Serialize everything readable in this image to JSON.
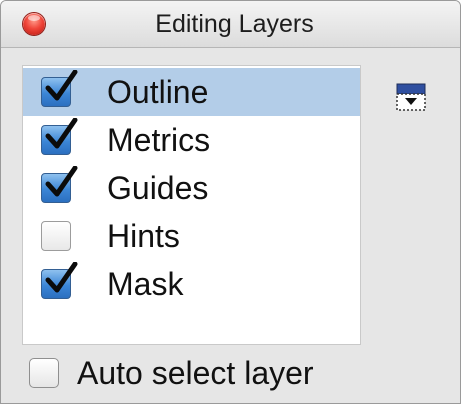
{
  "window": {
    "title": "Editing Layers"
  },
  "layers": [
    {
      "label": "Outline",
      "checked": true,
      "selected": true
    },
    {
      "label": "Metrics",
      "checked": true,
      "selected": false
    },
    {
      "label": "Guides",
      "checked": true,
      "selected": false
    },
    {
      "label": "Hints",
      "checked": false,
      "selected": false
    },
    {
      "label": "Mask",
      "checked": true,
      "selected": false
    }
  ],
  "options": {
    "auto_select_label": "Auto select layer",
    "auto_select_checked": false
  },
  "icons": {
    "close": "close-button",
    "menu": "panel-menu-icon"
  },
  "colors": {
    "selection": "#b3cde8",
    "checkbox_checked": "#3c86d6",
    "close_button": "#f0463a"
  }
}
